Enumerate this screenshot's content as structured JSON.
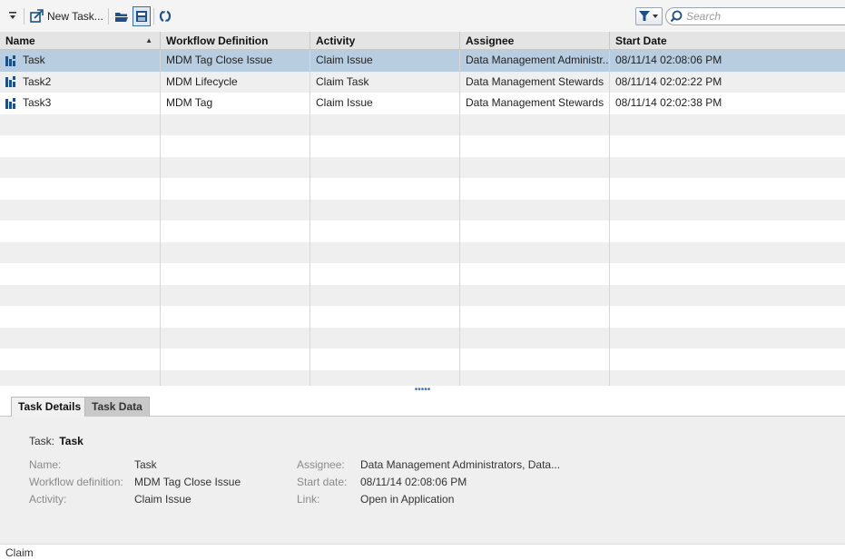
{
  "toolbar": {
    "collapse_icon": "collapse-icon",
    "new_task_icon": "new-task-icon",
    "new_task_label": "New Task...",
    "open_icon": "folder-open-icon",
    "save_icon": "save-icon",
    "refresh_icon": "refresh-icon",
    "filter_icon": "filter-icon",
    "search_icon": "search-icon",
    "search_placeholder": "Search"
  },
  "grid": {
    "columns": [
      {
        "label": "Name",
        "sort": "ascending"
      },
      {
        "label": "Workflow Definition"
      },
      {
        "label": "Activity"
      },
      {
        "label": "Assignee"
      },
      {
        "label": "Start Date"
      }
    ],
    "rows": [
      {
        "name": "Task",
        "workflow": "MDM Tag Close Issue",
        "activity": "Claim Issue",
        "assignee": "Data Management Administr...",
        "start": "08/11/14 02:08:06 PM",
        "selected": true
      },
      {
        "name": "Task2",
        "workflow": "MDM Lifecycle",
        "activity": "Claim Task",
        "assignee": "Data Management Stewards",
        "start": "08/11/14 02:02:22 PM"
      },
      {
        "name": "Task3",
        "workflow": "MDM Tag",
        "activity": "Claim Issue",
        "assignee": "Data Management Stewards",
        "start": "08/11/14 02:02:38 PM"
      }
    ],
    "selected_color": "#b8cde0"
  },
  "tabs": {
    "task_details": "Task Details",
    "task_data": "Task Data"
  },
  "details": {
    "title_label": "Task:",
    "title_value": "Task",
    "name_label": "Name:",
    "name_value": "Task",
    "workflow_label": "Workflow definition:",
    "workflow_value": "MDM Tag Close Issue",
    "activity_label": "Activity:",
    "activity_value": "Claim Issue",
    "assignee_label": "Assignee:",
    "assignee_value": "Data Management Administrators, Data...",
    "start_label": "Start date:",
    "start_value": "08/11/14 02:08:06 PM",
    "link_label": "Link:",
    "link_value": "Open in Application"
  },
  "status": {
    "text": "Claim"
  }
}
